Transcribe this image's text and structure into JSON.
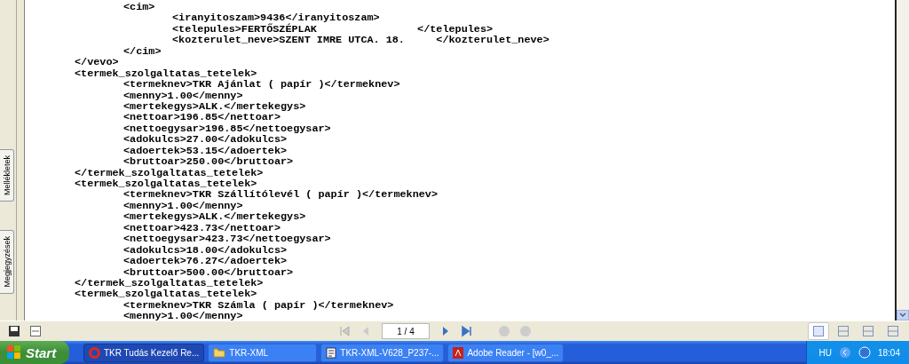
{
  "side_tabs": [
    {
      "label": "Mellékletek",
      "selected": false
    },
    {
      "label": "Megjegyzések",
      "selected": false
    }
  ],
  "document": {
    "nodes": [
      {
        "children": [
          {
            "line": "<cim>",
            "children": [
              {
                "line": "<iranyitoszam>9436</iranyitoszam>"
              },
              {
                "line": "<telepules>FERTŐSZÉPLAK                </telepules>"
              },
              {
                "line": "<kozterulet_neve>SZENT IMRE UTCA. 18.     </kozterulet_neve>"
              }
            ],
            "close": "</cim>"
          }
        ],
        "close": "</vevo>"
      },
      {
        "line": "<termek_szolgaltatas_tetelek>",
        "children": [
          {
            "line": "<termeknev>TKR Ajánlat ( papír )</termeknev>"
          },
          {
            "line": "<menny>1.00</menny>"
          },
          {
            "line": "<mertekegys>ALK.</mertekegys>"
          },
          {
            "line": "<nettoar>196.85</nettoar>"
          },
          {
            "line": "<nettoegysar>196.85</nettoegysar>"
          },
          {
            "line": "<adokulcs>27.00</adokulcs>"
          },
          {
            "line": "<adoertek>53.15</adoertek>"
          },
          {
            "line": "<bruttoar>250.00</bruttoar>"
          }
        ],
        "close": "</termek_szolgaltatas_tetelek>"
      },
      {
        "line": "<termek_szolgaltatas_tetelek>",
        "children": [
          {
            "line": "<termeknev>TKR Szállítólevél ( papír )</termeknev>"
          },
          {
            "line": "<menny>1.00</menny>"
          },
          {
            "line": "<mertekegys>ALK.</mertekegys>"
          },
          {
            "line": "<nettoar>423.73</nettoar>"
          },
          {
            "line": "<nettoegysar>423.73</nettoegysar>"
          },
          {
            "line": "<adokulcs>18.00</adokulcs>"
          },
          {
            "line": "<adoertek>76.27</adoertek>"
          },
          {
            "line": "<bruttoar>500.00</bruttoar>"
          }
        ],
        "close": "</termek_szolgaltatas_tetelek>"
      },
      {
        "line": "<termek_szolgaltatas_tetelek>",
        "children": [
          {
            "line": "<termeknev>TKR Számla ( papír )</termeknev>"
          },
          {
            "line": "<menny>1.00</menny>"
          }
        ]
      }
    ]
  },
  "toolbar": {
    "page_field": "1 / 4",
    "views": [
      {
        "selected": true
      },
      {
        "selected": false
      },
      {
        "selected": false
      },
      {
        "selected": false
      }
    ]
  },
  "taskbar": {
    "start": "Start",
    "tasks": [
      {
        "label": "TKR Tudás Kezelő Re...",
        "kind": "browser",
        "selected": true
      },
      {
        "label": "TKR-XML",
        "kind": "folder",
        "selected": false
      },
      {
        "label": "TKR-XML-V628_P237-...",
        "kind": "document",
        "selected": false
      },
      {
        "label": "Adobe Reader - [w0_...",
        "kind": "reader",
        "selected": false
      }
    ],
    "language": "HU",
    "clock": "18:04"
  }
}
